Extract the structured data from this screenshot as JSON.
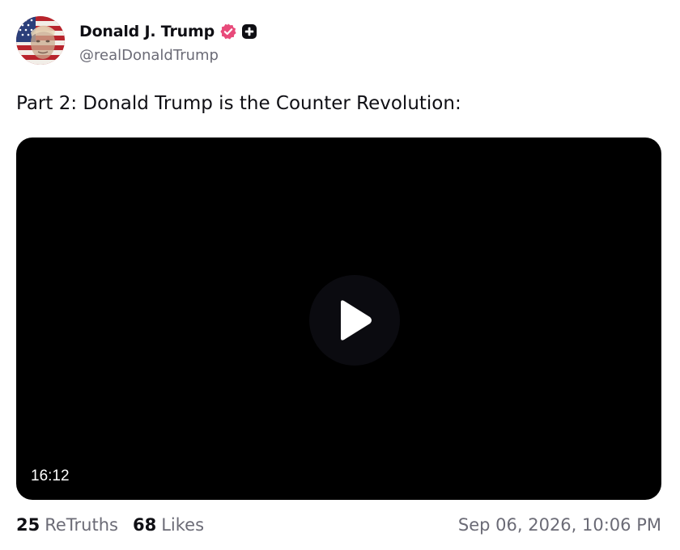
{
  "author": {
    "display_name": "Donald J. Trump",
    "handle": "@realDonaldTrump",
    "avatar_icon": "flag-portrait-avatar",
    "verified_icon": "verified-badge-icon",
    "verified_color": "#e84a7a",
    "badge_icon": "plus-badge-icon"
  },
  "post": {
    "text": "Part 2: Donald Trump is the Counter Revolution:"
  },
  "video": {
    "duration": "16:12",
    "play_icon": "play-icon"
  },
  "stats": {
    "retruths_count": "25",
    "retruths_label": "ReTruths",
    "likes_count": "68",
    "likes_label": "Likes"
  },
  "timestamp": "Sep 06, 2026, 10:06 PM",
  "colors": {
    "text_primary": "#0f0f14",
    "text_secondary": "#6b6b76",
    "video_bg": "#000000"
  }
}
